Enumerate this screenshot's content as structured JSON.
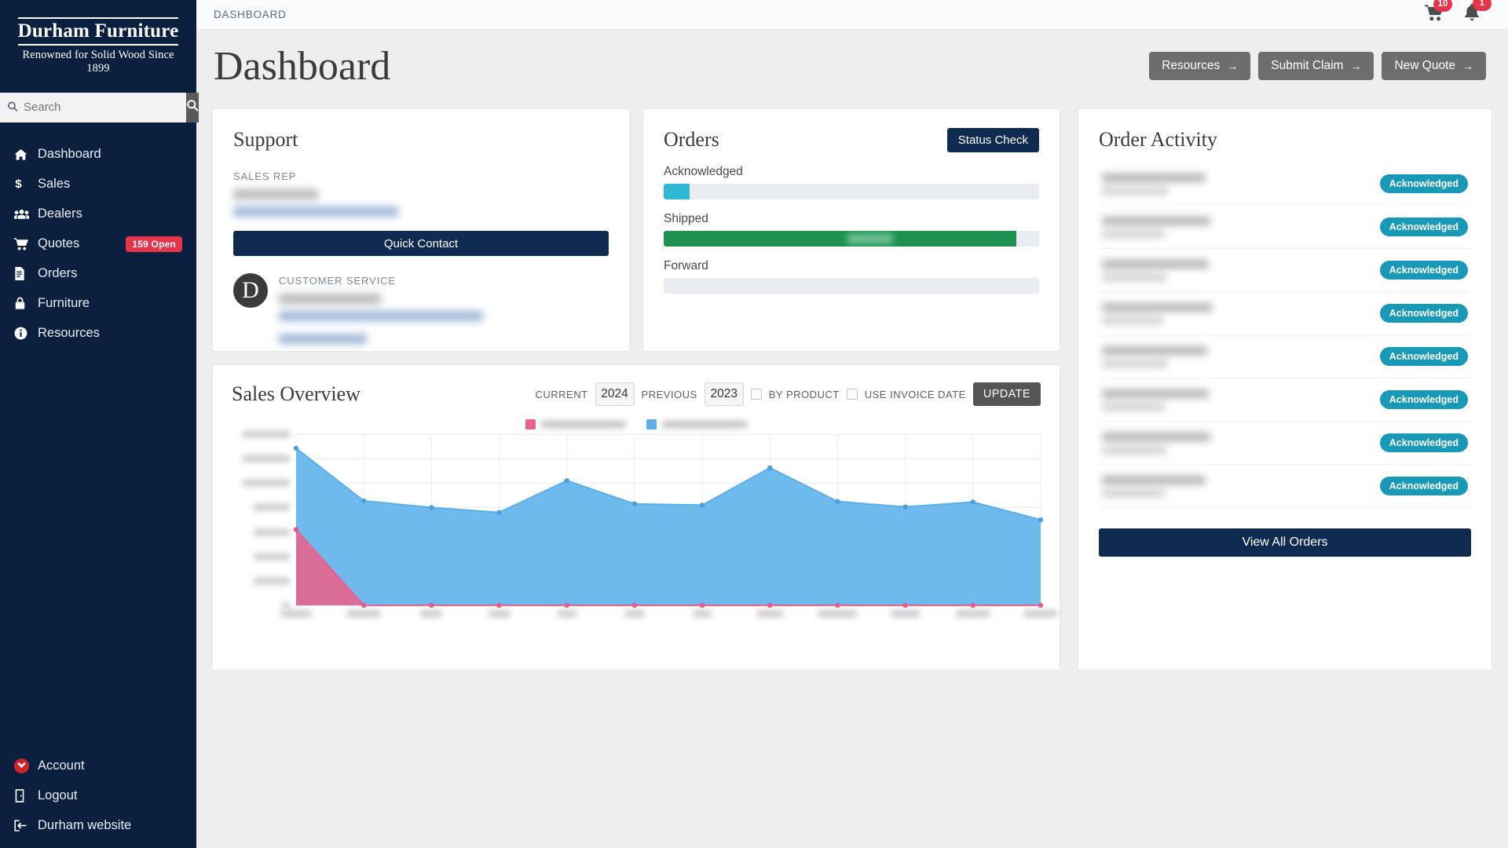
{
  "brand": {
    "name": "Durham Furniture",
    "tagline": "Renowned for Solid Wood Since 1899",
    "monogram": "D"
  },
  "search": {
    "placeholder": "Search",
    "icon": "search-icon",
    "button_icon": "search-icon"
  },
  "sidebar": {
    "main_items": [
      {
        "label": "Dashboard",
        "icon": "home-icon",
        "badge": null
      },
      {
        "label": "Sales",
        "icon": "dollar-icon",
        "badge": null
      },
      {
        "label": "Dealers",
        "icon": "users-icon",
        "badge": null
      },
      {
        "label": "Quotes",
        "icon": "cart-icon",
        "badge": "159 Open"
      },
      {
        "label": "Orders",
        "icon": "document-icon",
        "badge": null
      },
      {
        "label": "Furniture",
        "icon": "lock-icon",
        "badge": null
      },
      {
        "label": "Resources",
        "icon": "info-icon",
        "badge": null
      }
    ],
    "bottom_items": [
      {
        "label": "Account",
        "icon": "avatar-icon"
      },
      {
        "label": "Logout",
        "icon": "door-exit-icon"
      },
      {
        "label": "Durham website",
        "icon": "external-link-icon"
      }
    ]
  },
  "topbar": {
    "breadcrumb": "DASHBOARD",
    "cart_icon": "cart-icon",
    "cart_count": "10",
    "bell_icon": "bell-icon",
    "bell_count": "1"
  },
  "header": {
    "title": "Dashboard",
    "actions": [
      {
        "label": "Resources",
        "arrow": "→"
      },
      {
        "label": "Submit Claim",
        "arrow": "→"
      },
      {
        "label": "New Quote",
        "arrow": "→"
      }
    ]
  },
  "support": {
    "title": "Support",
    "sales_rep_caption": "SALES REP",
    "quick_contact_label": "Quick Contact",
    "customer_service_caption": "CUSTOMER SERVICE",
    "redacted": true
  },
  "orders": {
    "title": "Orders",
    "status_check_label": "Status Check",
    "bars": [
      {
        "label": "Acknowledged",
        "percent": 7,
        "color": "#2eb8d6"
      },
      {
        "label": "Shipped",
        "percent": 94,
        "color": "#1e9150"
      },
      {
        "label": "Forward",
        "percent": 0,
        "color": "#e9edf1"
      }
    ]
  },
  "activity": {
    "title": "Order Activity",
    "rows": [
      {
        "status": "Acknowledged"
      },
      {
        "status": "Acknowledged"
      },
      {
        "status": "Acknowledged"
      },
      {
        "status": "Acknowledged"
      },
      {
        "status": "Acknowledged"
      },
      {
        "status": "Acknowledged"
      },
      {
        "status": "Acknowledged"
      },
      {
        "status": "Acknowledged"
      }
    ],
    "view_all_label": "View All Orders",
    "redacted": true
  },
  "sales": {
    "title": "Sales Overview",
    "current_caption": "CURRENT",
    "current_year": "2024",
    "previous_caption": "PREVIOUS",
    "previous_year": "2023",
    "by_product_label": "BY PRODUCT",
    "by_product_checked": false,
    "use_invoice_date_label": "USE INVOICE DATE",
    "use_invoice_date_checked": false,
    "update_label": "UPDATE"
  },
  "chart_data": {
    "type": "area",
    "title": "Sales Overview",
    "xlabel": "",
    "ylabel": "",
    "grid": true,
    "legend_position": "top-center",
    "labels_redacted": true,
    "categories": [
      "January",
      "February",
      "March",
      "April",
      "May",
      "June",
      "July",
      "August",
      "September",
      "October",
      "November",
      "December"
    ],
    "ylim": [
      0,
      1400000
    ],
    "yticks": [
      0,
      200000,
      400000,
      600000,
      800000,
      1000000,
      1200000,
      1400000
    ],
    "series": [
      {
        "name": "Current Year",
        "color": "#e8628c",
        "fill": "#e8628c",
        "values": [
          620000,
          0,
          0,
          0,
          0,
          0,
          0,
          0,
          0,
          0,
          0,
          0
        ]
      },
      {
        "name": "Previous Year",
        "color": "#5bafe8",
        "fill": "#62b4ec",
        "values": [
          1285000,
          855000,
          800000,
          760000,
          1020000,
          830000,
          820000,
          1125000,
          850000,
          805000,
          845000,
          700000
        ]
      }
    ]
  },
  "colors": {
    "sidebar_bg": "#0b1f3f",
    "accent_navy": "#0f2b52",
    "badge_red": "#e8344a",
    "pill_cyan": "#1899b8",
    "progress_green": "#1e9150",
    "progress_cyan": "#2eb8d6",
    "series_pink": "#e8628c",
    "series_blue": "#62b4ec"
  }
}
